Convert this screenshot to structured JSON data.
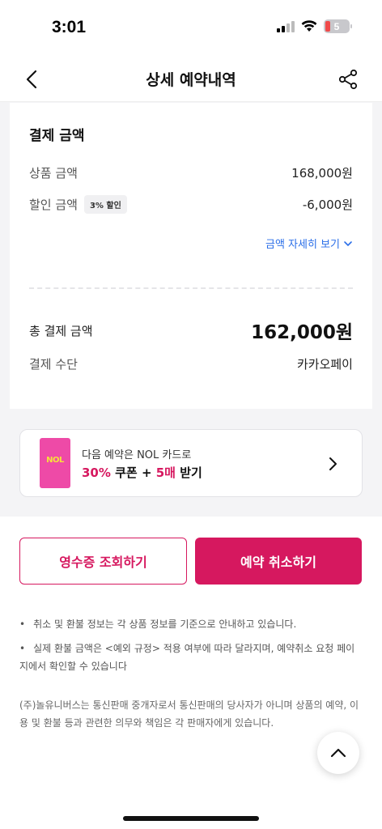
{
  "status_bar": {
    "time": "3:01",
    "battery": "5"
  },
  "header": {
    "title": "상세 예약내역"
  },
  "payment": {
    "title": "결제 금액",
    "product_label": "상품 금액",
    "product_value": "168,000원",
    "discount_label": "할인 금액",
    "discount_badge": "3% 할인",
    "discount_value": "-6,000원",
    "detail_link": "금액 자세히 보기",
    "total_label": "총 결제 금액",
    "total_value": "162,000원",
    "method_label": "결제 수단",
    "method_value": "카카오페이"
  },
  "promo": {
    "card_text": "NOL",
    "line1": "다음 예약은 NOL 카드로",
    "line2_pct": "30%",
    "line2_mid": " 쿠폰 + ",
    "line2_count": "5매",
    "line2_end": " 받기"
  },
  "actions": {
    "receipt_label": "영수증 조회하기",
    "cancel_label": "예약 취소하기"
  },
  "notices": [
    "취소 및 환불 정보는 각 상품 정보를 기준으로 안내하고 있습니다.",
    "실제 환불 금액은 <예외 규정> 적용 여부에 따라 달라지며, 예약취소 요청 페이지에서 확인할 수 있습니다"
  ],
  "disclaimer": "(주)놀유니버스는 통신판매 중개자로서 통신판매의 당사자가 아니며 상품의 예약, 이용 및 환불 등과 관련한 의무와 책임은 각 판매자에게 있습니다.",
  "colors": {
    "accent": "#d6185f",
    "link": "#2a6ee8",
    "card_pink": "#ee4aa7"
  },
  "icons": [
    "back-arrow-icon",
    "share-icon",
    "chevron-down-icon",
    "chevron-right-icon",
    "chevron-up-icon",
    "signal-icon",
    "wifi-icon",
    "battery-icon"
  ]
}
